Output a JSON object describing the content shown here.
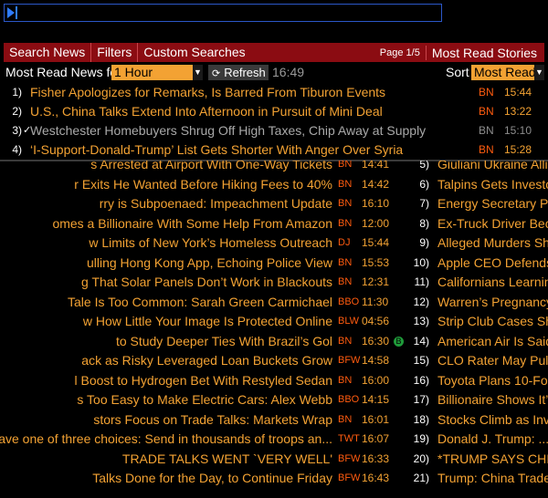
{
  "menu": {
    "items": [
      "Search News",
      "Filters",
      "Custom Searches"
    ],
    "page_info": "Page 1/5",
    "most_read_stories": "Most Read Stories"
  },
  "controls": {
    "label": "Most Read News for",
    "period": "1 Hour",
    "refresh": "Refresh",
    "time": "16:49",
    "sort_label": "Sort",
    "sort_value": "Most Read"
  },
  "top_stories": [
    {
      "num": "1)",
      "title": "Fisher Apologizes for Remarks, Is Barred From Tiburon Events",
      "src": "BN",
      "time": "15:44",
      "read": false
    },
    {
      "num": "2)",
      "title": "U.S., China Talks Extend Into Afternoon in Pursuit of Mini Deal",
      "src": "BN",
      "time": "13:22",
      "read": false
    },
    {
      "num": "3)",
      "check": "✓",
      "title": "Westchester Homebuyers Shrug Off High Taxes, Chip Away at Supply",
      "src": "BN",
      "time": "15:10",
      "read": true
    },
    {
      "num": "4)",
      "title": "‘I-Support-Donald-Trump’ List Gets Shorter With Anger Over Syria",
      "src": "BN",
      "time": "15:28",
      "read": false
    }
  ],
  "left_stories": [
    {
      "title": "s Arrested at Airport With One-Way Tickets",
      "src": "BN",
      "time": "14:41"
    },
    {
      "title": "r Exits He Wanted Before Hiking Fees to 40%",
      "src": "BN",
      "time": "14:42"
    },
    {
      "title": "rry is Subpoenaed: Impeachment Update",
      "src": "BN",
      "time": "16:10"
    },
    {
      "title": "omes a Billionaire With Some Help From Amazon",
      "src": "BN",
      "time": "12:00"
    },
    {
      "title": "w Limits of New York’s Homeless Outreach",
      "src": "DJ",
      "time": "15:44"
    },
    {
      "title": "ulling Hong Kong App, Echoing Police View",
      "src": "BN",
      "time": "15:53"
    },
    {
      "title": "g That Solar Panels Don’t Work in Blackouts",
      "src": "BN",
      "time": "12:31"
    },
    {
      "title": "Tale Is Too Common: Sarah Green Carmichael",
      "src": "BBO",
      "time": "11:30"
    },
    {
      "title": "w How Little Your Image Is Protected Online",
      "src": "BLW",
      "time": "04:56"
    },
    {
      "title": "to Study Deeper Ties With Brazil’s Gol",
      "src": "BN",
      "time": "16:30",
      "badge": "B"
    },
    {
      "title": "ack as Risky Leveraged Loan Buckets Grow",
      "src": "BFW",
      "time": "14:58"
    },
    {
      "title": "l Boost to Hydrogen Bet With Restyled Sedan",
      "src": "BN",
      "time": "16:00"
    },
    {
      "title": "s Too Easy to Make Electric Cars: Alex Webb",
      "src": "BBO",
      "time": "14:15"
    },
    {
      "title": "stors Focus on Trade Talks: Markets Wrap",
      "src": "BN",
      "time": "16:01"
    },
    {
      "title": "e have one of three choices: Send in thousands of troops an...",
      "src": "TWT",
      "time": "16:07"
    },
    {
      "title": "TRADE TALKS WENT `VERY WELL'",
      "src": "BFW",
      "time": "16:33"
    },
    {
      "title": "Talks Done for the Day, to Continue Friday",
      "src": "BFW",
      "time": "16:43"
    }
  ],
  "right_stories": [
    {
      "num": "5)",
      "title": "Giuliani Ukraine Allie"
    },
    {
      "num": "6)",
      "title": "Talpins Gets Investo"
    },
    {
      "num": "7)",
      "title": "Energy Secretary Per"
    },
    {
      "num": "8)",
      "title": "Ex-Truck Driver Beco"
    },
    {
      "num": "9)",
      "title": "Alleged Murders Show"
    },
    {
      "num": "10)",
      "title": "Apple CEO Defends P"
    },
    {
      "num": "11)",
      "title": "Californians Learning"
    },
    {
      "num": "12)",
      "title": "Warren’s Pregnancy T"
    },
    {
      "num": "13)",
      "title": "Strip Club Cases Show"
    },
    {
      "num": "14)",
      "title": "American Air Is Said"
    },
    {
      "num": "15)",
      "title": "CLO Rater May Pull B"
    },
    {
      "num": "16)",
      "title": "Toyota Plans 10-Folc"
    },
    {
      "num": "17)",
      "title": "Billionaire Shows It’s"
    },
    {
      "num": "18)",
      "title": "Stocks Climb as Inve"
    },
    {
      "num": "19)",
      "title": "Donald J. Trump: ..."
    },
    {
      "num": "20)",
      "title": "*TRUMP SAYS CHINA"
    },
    {
      "num": "21)",
      "title": "Trump: China Trade T"
    }
  ],
  "colors": {
    "accent": "#f3a233",
    "menu": "#8b0c12",
    "source": "#ff5b0f",
    "read": "#a9a9a9"
  }
}
